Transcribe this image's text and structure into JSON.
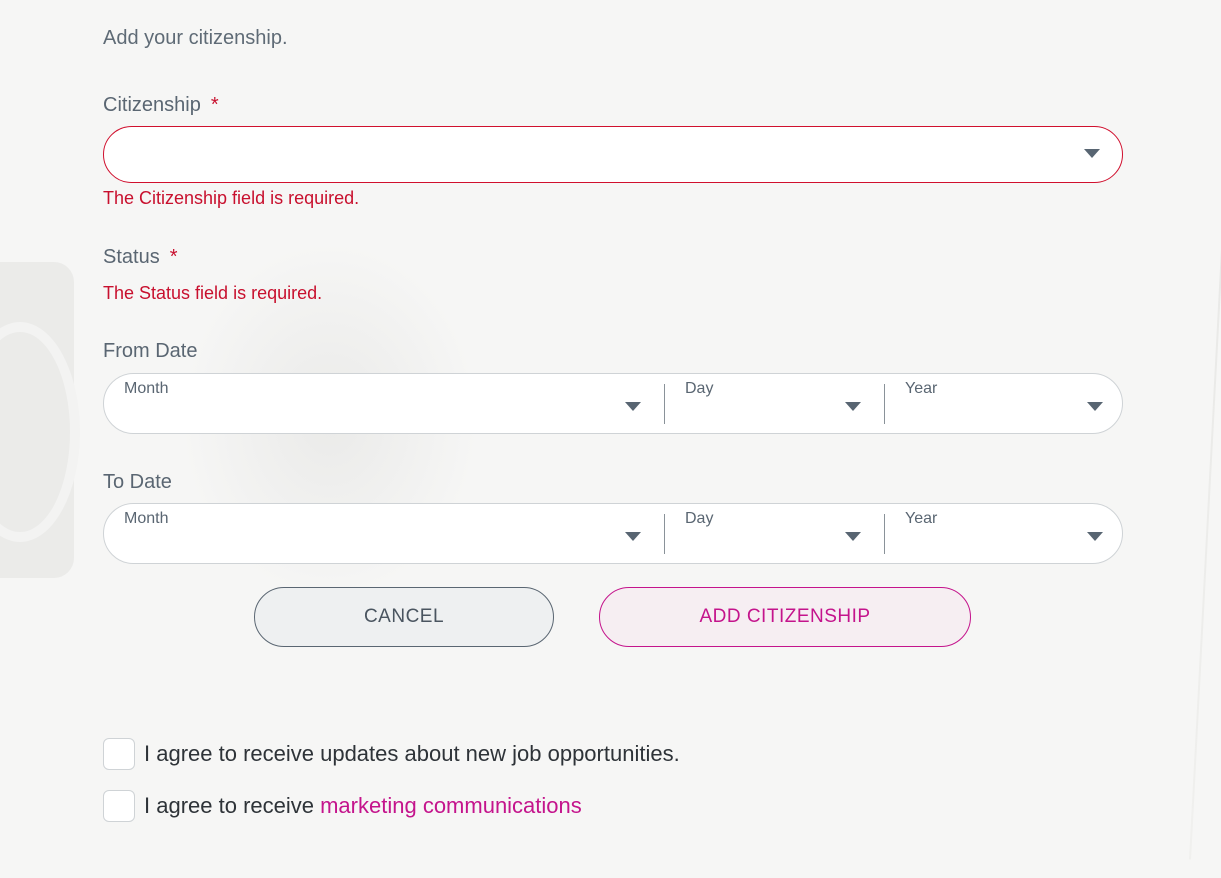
{
  "intro": "Add your citizenship.",
  "citizenship": {
    "label": "Citizenship",
    "required_mark": "*",
    "value": "",
    "error": "The Citizenship field is required."
  },
  "status": {
    "label": "Status",
    "required_mark": "*",
    "error": "The Status field is required."
  },
  "from_date": {
    "label": "From Date",
    "month_label": "Month",
    "day_label": "Day",
    "year_label": "Year"
  },
  "to_date": {
    "label": "To Date",
    "month_label": "Month",
    "day_label": "Day",
    "year_label": "Year"
  },
  "buttons": {
    "cancel": "CANCEL",
    "add": "ADD CITIZENSHIP"
  },
  "consents": {
    "job_updates": {
      "text": "I agree to receive updates about new job opportunities.",
      "checked": false
    },
    "marketing": {
      "prefix": "I agree to receive ",
      "link_text": "marketing communications",
      "checked": false
    }
  },
  "colors": {
    "error": "#c8102e",
    "accent": "#c4148c",
    "text": "#5a6672"
  },
  "icons": {
    "dropdown": "chevron-down-icon"
  }
}
